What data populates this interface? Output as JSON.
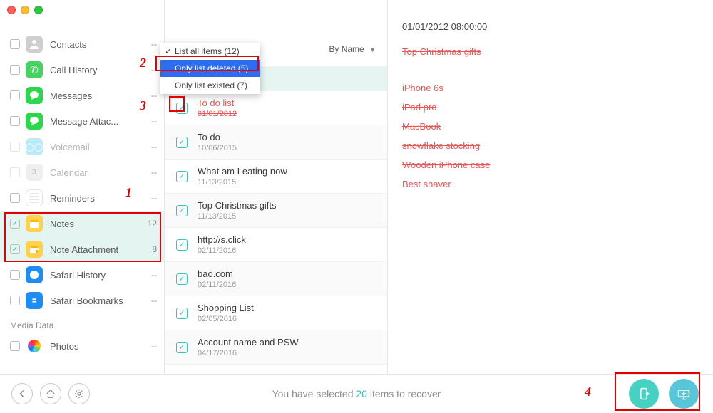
{
  "search": {
    "placeholder": ""
  },
  "filter": {
    "current_label": "List all items (12)",
    "options": [
      {
        "label": "List all items (12)",
        "checked": true,
        "highlight": false
      },
      {
        "label": "Only list deleted (5)",
        "checked": false,
        "highlight": true
      },
      {
        "label": "Only list existed (7)",
        "checked": false,
        "highlight": false
      }
    ]
  },
  "sort": {
    "label": "By Name"
  },
  "sidebar": {
    "section_label": "Media Data",
    "items": [
      {
        "label": "Contacts",
        "count": "--",
        "checked": false,
        "disabled": false
      },
      {
        "label": "Call History",
        "count": "--",
        "checked": false,
        "disabled": false
      },
      {
        "label": "Messages",
        "count": "--",
        "checked": false,
        "disabled": false
      },
      {
        "label": "Message Attac...",
        "count": "--",
        "checked": false,
        "disabled": false
      },
      {
        "label": "Voicemail",
        "count": "--",
        "checked": false,
        "disabled": true
      },
      {
        "label": "Calendar",
        "count": "--",
        "checked": false,
        "disabled": true
      },
      {
        "label": "Reminders",
        "count": "--",
        "checked": false,
        "disabled": false
      },
      {
        "label": "Notes",
        "count": "12",
        "checked": true,
        "disabled": false,
        "selected": true
      },
      {
        "label": "Note Attachment",
        "count": "8",
        "checked": true,
        "disabled": false,
        "selected": true
      },
      {
        "label": "Safari History",
        "count": "--",
        "checked": false,
        "disabled": false
      },
      {
        "label": "Safari Bookmarks",
        "count": "--",
        "checked": false,
        "disabled": false
      },
      {
        "label": "Photos",
        "count": "--",
        "checked": false,
        "disabled": false
      }
    ]
  },
  "notes": [
    {
      "title": "",
      "date": "",
      "deleted": false,
      "empty": true,
      "current": true
    },
    {
      "title": "To do list",
      "date": "01/01/2012",
      "deleted": true,
      "empty": false,
      "current": false
    },
    {
      "title": "To do",
      "date": "10/06/2015",
      "deleted": false,
      "empty": false,
      "current": false
    },
    {
      "title": "What am I eating now",
      "date": "11/13/2015",
      "deleted": false,
      "empty": false,
      "current": false
    },
    {
      "title": "Top Christmas gifts",
      "date": "11/13/2015",
      "deleted": false,
      "empty": false,
      "current": false
    },
    {
      "title": "http://s.click",
      "date": "02/11/2016",
      "deleted": false,
      "empty": false,
      "current": false
    },
    {
      "title": "bao.com",
      "date": "02/11/2016",
      "deleted": false,
      "empty": false,
      "current": false
    },
    {
      "title": "Shopping List",
      "date": "02/05/2016",
      "deleted": false,
      "empty": false,
      "current": false
    },
    {
      "title": "Account name and PSW",
      "date": "04/17/2016",
      "deleted": false,
      "empty": false,
      "current": false
    }
  ],
  "detail": {
    "date": "01/01/2012 08:00:00",
    "title": "Top Christmas gifts",
    "lines": [
      "iPhone 6s",
      "iPad pro",
      "MacBook",
      "snowflake stocking",
      "Wooden iPhone case",
      "Best shaver"
    ]
  },
  "footer": {
    "prefix": "You have selected ",
    "count": "20",
    "suffix": " items to recover"
  },
  "annotations": {
    "n1": "1",
    "n2": "2",
    "n3": "3",
    "n4": "4"
  }
}
